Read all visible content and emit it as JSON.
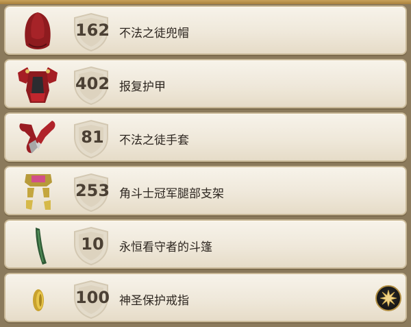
{
  "items": [
    {
      "level": "162",
      "name": "不法之徒兜帽",
      "icon": "hood-icon"
    },
    {
      "level": "402",
      "name": "报复护甲",
      "icon": "armor-icon"
    },
    {
      "level": "81",
      "name": "不法之徒手套",
      "icon": "gloves-icon"
    },
    {
      "level": "253",
      "name": "角斗士冠军腿部支架",
      "icon": "leg-braces-icon"
    },
    {
      "level": "10",
      "name": "永恒看守者的斗篷",
      "icon": "cloak-icon"
    },
    {
      "level": "100",
      "name": "神圣保护戒指",
      "icon": "ring-icon"
    }
  ],
  "action_icon": "star-burst-icon",
  "colors": {
    "row_bg": "#f2ece0",
    "row_border": "#c9b998",
    "level_text": "#4b4034",
    "name_text": "#2d2620",
    "background": "#8b7a5c",
    "accent_gold": "#b28f43"
  }
}
